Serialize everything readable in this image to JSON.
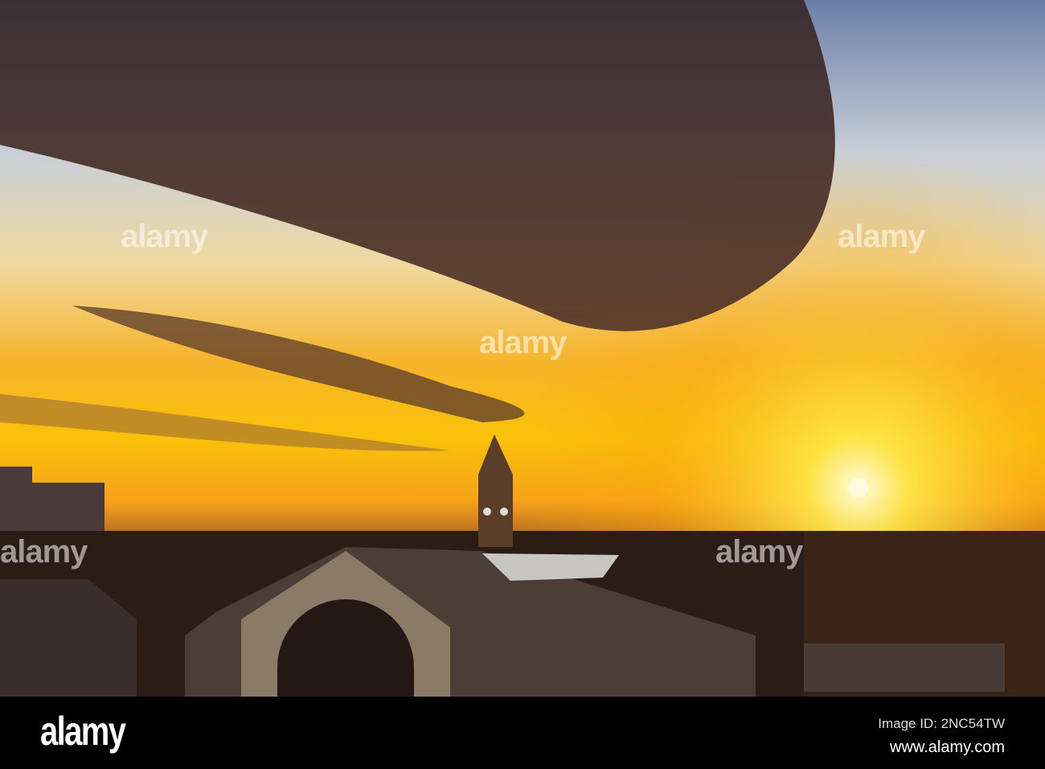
{
  "watermark": {
    "text": "alamy"
  },
  "footer": {
    "logo": "alamy",
    "image_id": "Image ID: 2NC54TW",
    "website": "www.alamy.com"
  },
  "colors": {
    "sun": "#fffbe0",
    "sky_top": "#6a7ea6",
    "glow": "#f9c20a",
    "cloud": "#3e2e2e",
    "footer": "#000000"
  }
}
